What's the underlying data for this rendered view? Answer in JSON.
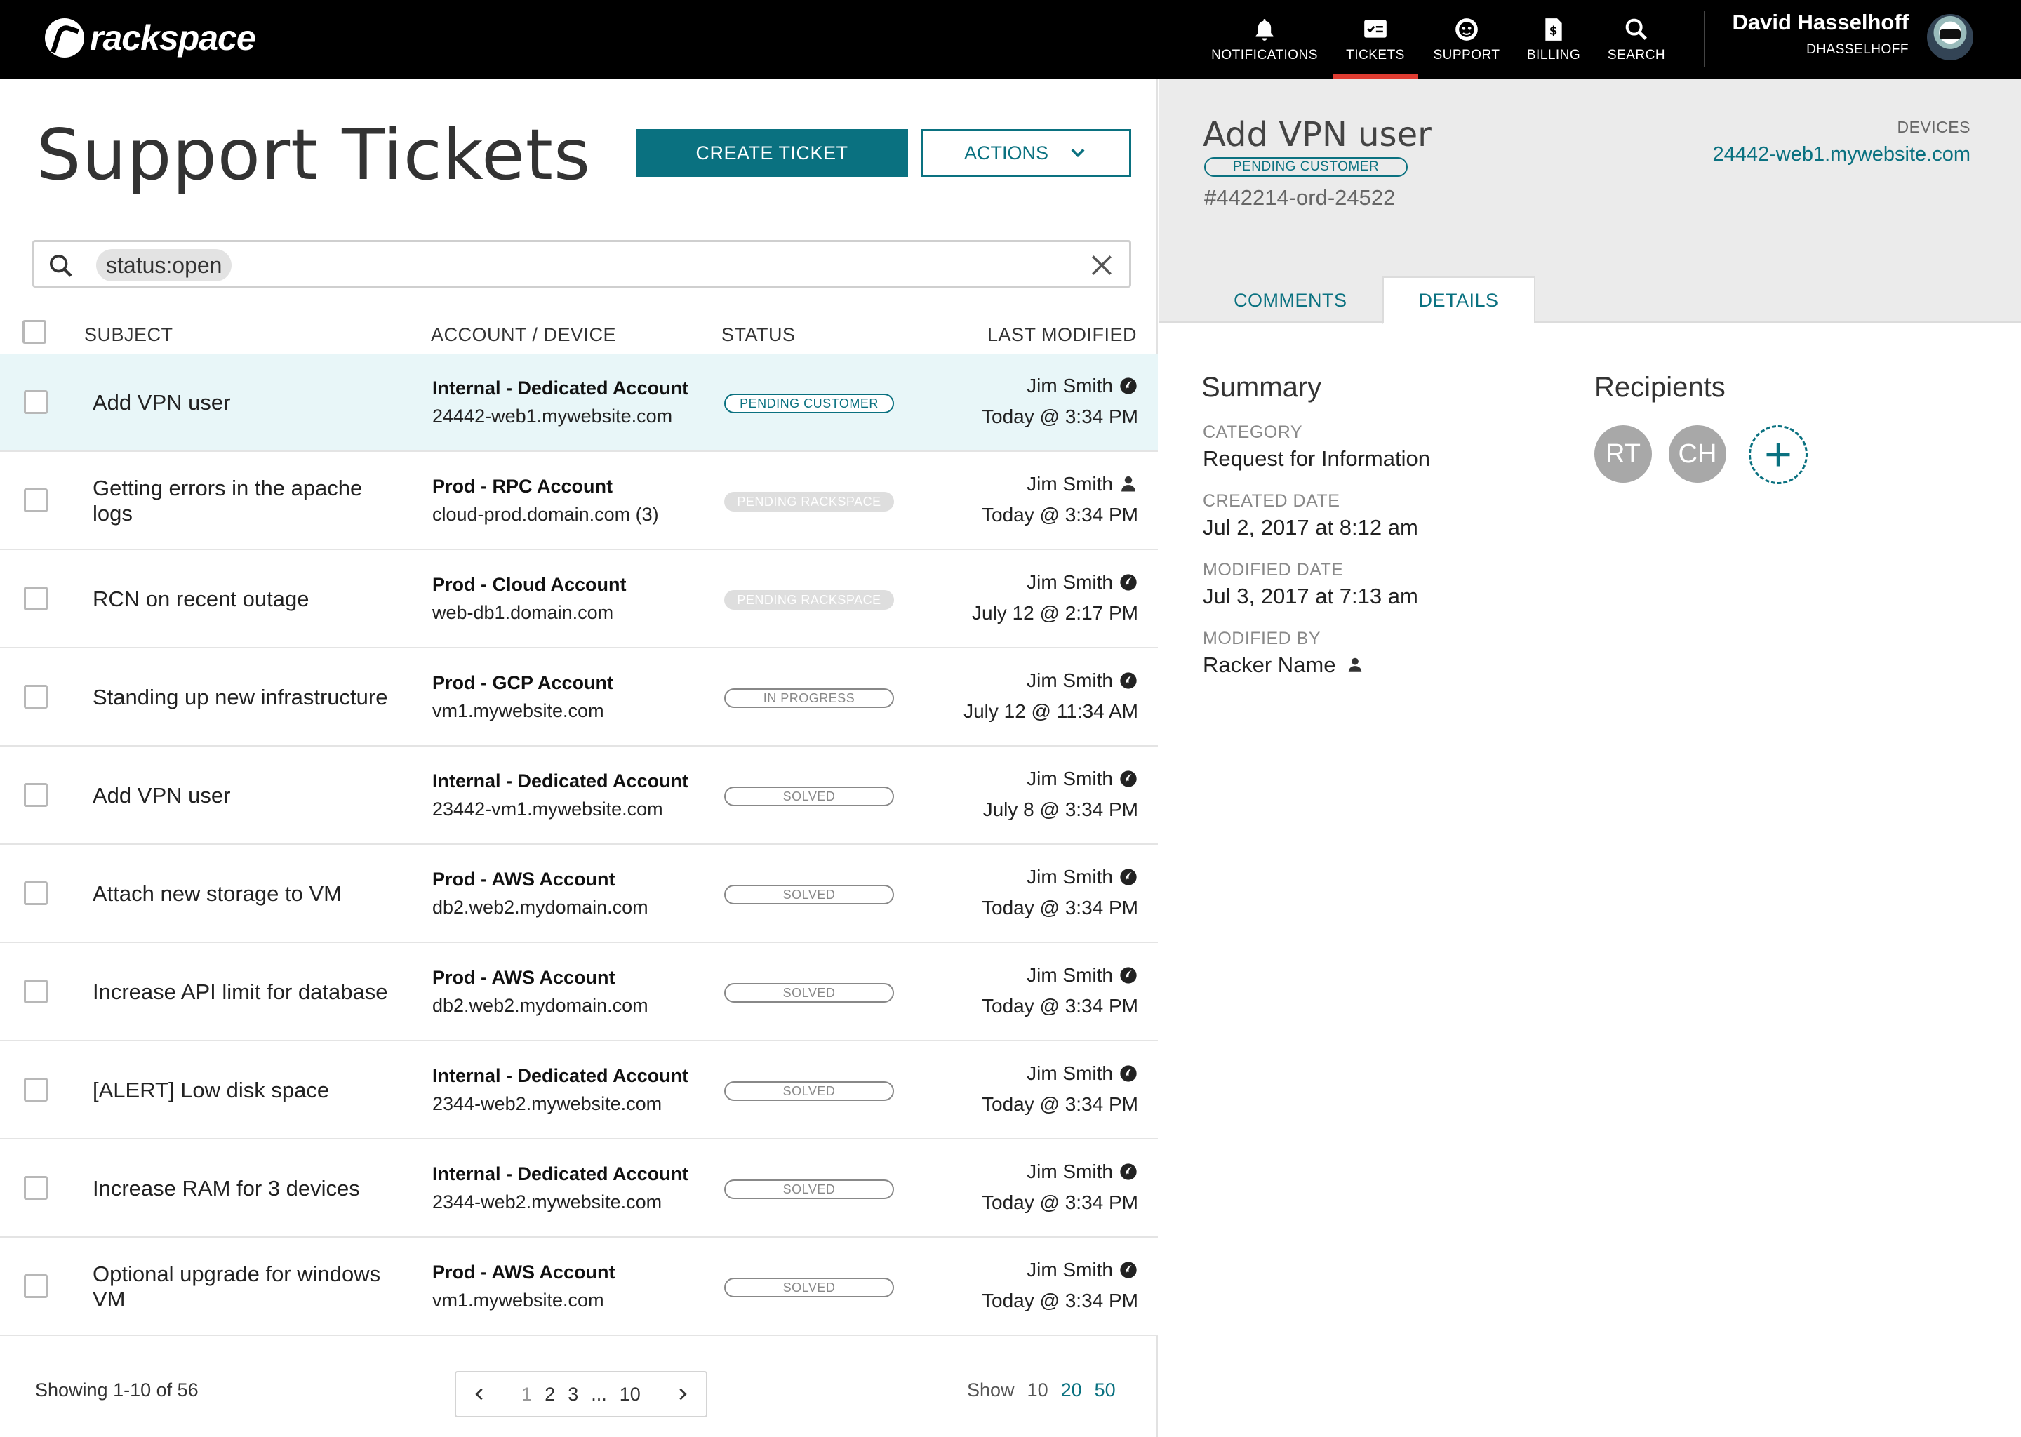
{
  "brand": {
    "name": "rackspace"
  },
  "nav": {
    "items": [
      {
        "label": "NOTIFICATIONS",
        "icon": "bell-icon"
      },
      {
        "label": "TICKETS",
        "icon": "tickets-icon",
        "active": true
      },
      {
        "label": "SUPPORT",
        "icon": "support-icon"
      },
      {
        "label": "BILLING",
        "icon": "billing-icon"
      },
      {
        "label": "SEARCH",
        "icon": "search-icon"
      }
    ],
    "user_name": "David Hasselhoff",
    "user_handle": "DHASSELHOFF"
  },
  "page": {
    "title": "Support Tickets",
    "create_label": "CREATE TICKET",
    "actions_label": "ACTIONS"
  },
  "search": {
    "query": "status:open"
  },
  "table": {
    "columns": [
      "SUBJECT",
      "ACCOUNT / DEVICE",
      "STATUS",
      "LAST MODIFIED"
    ],
    "rows": [
      {
        "subject": "Add VPN user",
        "account": "Internal - Dedicated Account",
        "device": "24442-web1.mywebsite.com",
        "status": "PENDING CUSTOMER",
        "status_type": "customer",
        "modified_by": "Jim Smith",
        "modified_by_icon": "rackspace-icon",
        "modified_at": "Today @ 3:34 PM",
        "selected": true
      },
      {
        "subject": "Getting errors in the apache logs",
        "account": "Prod - RPC Account",
        "device": "cloud-prod.domain.com (3)",
        "status": "PENDING RACKSPACE",
        "status_type": "rackspace",
        "modified_by": "Jim Smith",
        "modified_by_icon": "user-icon",
        "modified_at": "Today @ 3:34 PM"
      },
      {
        "subject": "RCN on recent outage",
        "account": "Prod - Cloud Account",
        "device": "web-db1.domain.com",
        "status": "PENDING RACKSPACE",
        "status_type": "rackspace",
        "modified_by": "Jim Smith",
        "modified_by_icon": "rackspace-icon",
        "modified_at": "July 12 @ 2:17 PM"
      },
      {
        "subject": "Standing up new infrastructure",
        "account": "Prod - GCP Account",
        "device": "vm1.mywebsite.com",
        "status": "IN PROGRESS",
        "status_type": "progress",
        "modified_by": "Jim Smith",
        "modified_by_icon": "rackspace-icon",
        "modified_at": "July 12 @ 11:34 AM"
      },
      {
        "subject": "Add VPN user",
        "account": "Internal - Dedicated Account",
        "device": "23442-vm1.mywebsite.com",
        "status": "SOLVED",
        "status_type": "solved",
        "modified_by": "Jim Smith",
        "modified_by_icon": "rackspace-icon",
        "modified_at": "July 8 @ 3:34 PM"
      },
      {
        "subject": "Attach new storage to VM",
        "account": "Prod - AWS Account",
        "device": "db2.web2.mydomain.com",
        "status": "SOLVED",
        "status_type": "solved",
        "modified_by": "Jim Smith",
        "modified_by_icon": "rackspace-icon",
        "modified_at": "Today @ 3:34 PM"
      },
      {
        "subject": "Increase API limit for database",
        "account": "Prod - AWS Account",
        "device": "db2.web2.mydomain.com",
        "status": "SOLVED",
        "status_type": "solved",
        "modified_by": "Jim Smith",
        "modified_by_icon": "rackspace-icon",
        "modified_at": "Today @ 3:34 PM"
      },
      {
        "subject": "[ALERT] Low disk space",
        "account": "Internal - Dedicated Account",
        "device": "2344-web2.mywebsite.com",
        "status": "SOLVED",
        "status_type": "solved",
        "modified_by": "Jim Smith",
        "modified_by_icon": "rackspace-icon",
        "modified_at": "Today @ 3:34 PM"
      },
      {
        "subject": "Increase RAM for 3 devices",
        "account": "Internal - Dedicated Account",
        "device": "2344-web2.mywebsite.com",
        "status": "SOLVED",
        "status_type": "solved",
        "modified_by": "Jim Smith",
        "modified_by_icon": "rackspace-icon",
        "modified_at": "Today @ 3:34 PM"
      },
      {
        "subject": "Optional upgrade for windows VM",
        "account": "Prod - AWS Account",
        "device": "vm1.mywebsite.com",
        "status": "SOLVED",
        "status_type": "solved",
        "modified_by": "Jim Smith",
        "modified_by_icon": "rackspace-icon",
        "modified_at": "Today @ 3:34 PM"
      }
    ]
  },
  "footer": {
    "showing": "Showing 1-10 of 56",
    "pages": [
      "1",
      "2",
      "3",
      "...",
      "10"
    ],
    "current_page": "1",
    "show_label": "Show",
    "per_page": [
      "10",
      "20",
      "50"
    ],
    "current_per_page": "10"
  },
  "detail": {
    "title": "Add VPN user",
    "status": "PENDING CUSTOMER",
    "ticket_id": "#442214-ord-24522",
    "devices_label": "DEVICES",
    "device_link": "24442-web1.mywebsite.com",
    "tabs": [
      "COMMENTS",
      "DETAILS"
    ],
    "active_tab": "DETAILS",
    "summary_title": "Summary",
    "fields": [
      {
        "label": "CATEGORY",
        "value": "Request for Information"
      },
      {
        "label": "CREATED DATE",
        "value": "Jul 2, 2017 at 8:12 am"
      },
      {
        "label": "MODIFIED DATE",
        "value": "Jul 3, 2017 at 7:13 am"
      },
      {
        "label": "MODIFIED BY",
        "value": "Racker Name"
      }
    ],
    "recipients_title": "Recipients",
    "recipients": [
      "RT",
      "CH"
    ]
  },
  "colors": {
    "accent": "#0a7180",
    "nav_active": "#e03c31",
    "selected_row": "#e8f6f8"
  }
}
